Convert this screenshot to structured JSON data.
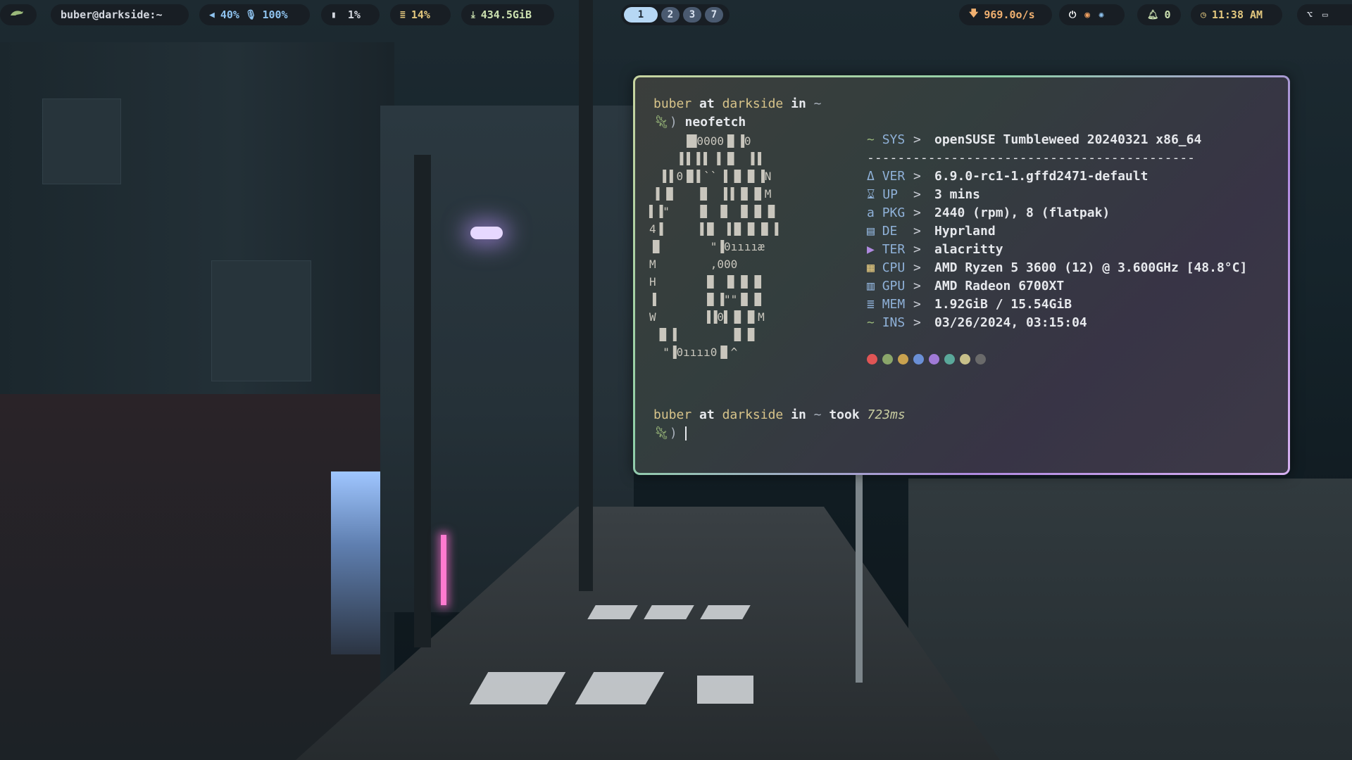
{
  "topbar": {
    "user_host": "buber@darkside:~",
    "volume": "40%",
    "mic": "100%",
    "cpu": "1%",
    "memory": "14%",
    "disk": "434.5GiB",
    "workspaces": [
      "1",
      "2",
      "3",
      "7"
    ],
    "network": "969.0o/s",
    "notifications": "0",
    "clock": "11:38 AM"
  },
  "terminal": {
    "prompt1": {
      "user": "buber",
      "at": "at",
      "host": "darkside",
      "in": "in",
      "dir": "~"
    },
    "command": "neofetch",
    "separator": "-------------------------------------------",
    "info": [
      {
        "key": "SYS",
        "icon": "chameleon-icon",
        "value": "openSUSE Tumbleweed 20240321 x86_64"
      },
      {
        "key": "VER",
        "icon": "penguin-icon",
        "value": "6.9.0-rc1-1.gffd2471-default"
      },
      {
        "key": "UP",
        "icon": "hourglass-icon",
        "value": "3 mins"
      },
      {
        "key": "PKG",
        "icon": "package-icon",
        "value": "2440 (rpm), 8 (flatpak)"
      },
      {
        "key": "DE",
        "icon": "desktop-icon",
        "value": "Hyprland"
      },
      {
        "key": "TER",
        "icon": "terminal-icon",
        "value": "alacritty"
      },
      {
        "key": "CPU",
        "icon": "cpu-icon",
        "value": "AMD Ryzen 5 3600 (12) @ 3.600GHz [48.8°C]"
      },
      {
        "key": "GPU",
        "icon": "gpu-icon",
        "value": "AMD Radeon 6700XT"
      },
      {
        "key": "MEM",
        "icon": "memory-icon",
        "value": "1.92GiB / 15.54GiB"
      },
      {
        "key": "INS",
        "icon": "chameleon-icon",
        "value": "03/26/2024, 03:15:04"
      }
    ],
    "palette": [
      "#e05555",
      "#8aa66a",
      "#c9a24f",
      "#6a8fd6",
      "#a07ad6",
      "#5aa89a",
      "#c8c08a",
      "#6a6a6a"
    ],
    "prompt2": {
      "user": "buber",
      "at": "at",
      "host": "darkside",
      "in": "in",
      "dir": "~",
      "took": "took",
      "duration": "723ms"
    },
    "ascii_art": "     ▐█0000▐▌▐0\n    ▐▐ ▌▌ ▌▐▌  ▌▌\n  ▌▌0▐▌▌`` ▌▐▌▐▌▐N\n ▌▐▌   ▐▌  ▌▌▐▌▐▌M\n▌▐\"    ▐▌ ▐▌ ▐▌▐▌▐▌\n4▐     ▐▐▌ ▐▐▌▐▌▐▌▐\n▐▌       \"▐0ııııæ\nM        ,000\nH       ▐▌ ▐▌▐▌▐▌\n▐       ▐▌▐\"\"▐▌▐▌\nW       ▐▐0▌▐▌▐▌M\n ▐▌▐        ▐▌▐▌\n  \"▐0ıııı0▐▌^"
  },
  "colors": {
    "accent": "#b6d7f4",
    "network": "#f0b070",
    "yellow": "#d8c48a",
    "green": "#9ab87a",
    "blue": "#8fb1d8"
  }
}
